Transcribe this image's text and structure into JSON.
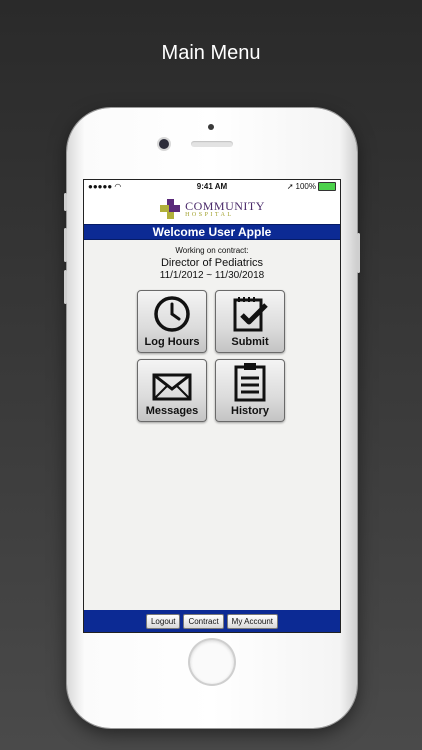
{
  "caption": "Main Menu",
  "status_bar": {
    "signal": "●●●●● ",
    "time": "9:41 AM",
    "battery": "100%"
  },
  "logo": {
    "name": "COMMUNITY",
    "sub": "HOSPITAL"
  },
  "welcome": "Welcome User Apple",
  "contract": {
    "label": "Working on contract:",
    "name": "Director of Pediatrics",
    "dates": "11/1/2012 ~ 11/30/2018"
  },
  "menu": {
    "log_hours": "Log Hours",
    "submit": "Submit",
    "messages": "Messages",
    "history": "History"
  },
  "footer": {
    "logout": "Logout",
    "contract": "Contract",
    "my_account": "My Account"
  },
  "colors": {
    "brand_blue": "#0c2a94",
    "logo_purple": "#4a2a6a",
    "logo_olive": "#a0a02a"
  }
}
